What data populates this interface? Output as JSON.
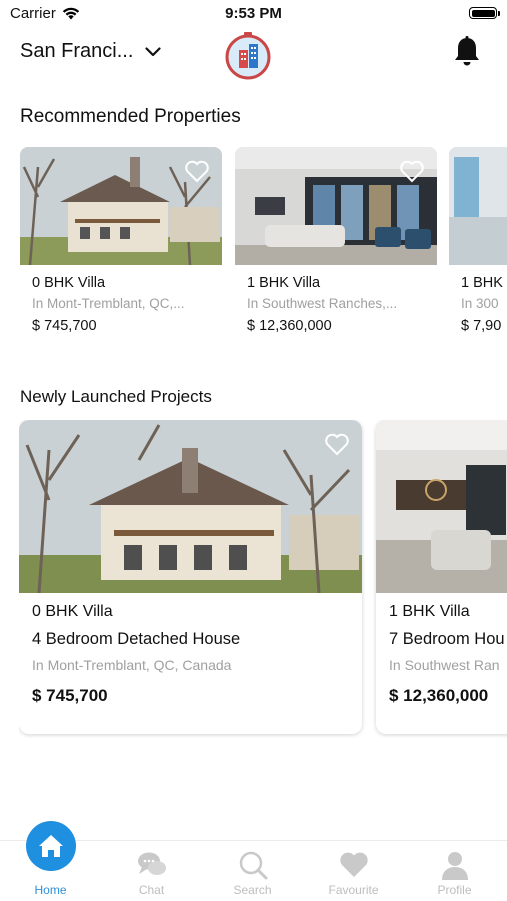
{
  "status": {
    "carrier": "Carrier",
    "time": "9:53 PM"
  },
  "header": {
    "city": "San Franci...",
    "icons": [
      "chevron-down-icon",
      "app-logo",
      "bell-icon"
    ]
  },
  "recommended": {
    "title": "Recommended Properties",
    "cards": [
      {
        "type": "0 BHK Villa",
        "location": "In Mont-Tremblant, QC,...",
        "price": "$ 745,700"
      },
      {
        "type": "1 BHK Villa",
        "location": "In Southwest Ranches,...",
        "price": "$ 12,360,000"
      },
      {
        "type": "1 BHK",
        "location": "In 300",
        "price": "$ 7,90"
      }
    ]
  },
  "new_projects": {
    "title": "Newly Launched Projects",
    "cards": [
      {
        "type": "0 BHK Villa",
        "name": "4 Bedroom Detached House",
        "location": "In Mont-Tremblant, QC, Canada",
        "price": "$ 745,700"
      },
      {
        "type": "1 BHK Villa",
        "name": "7 Bedroom Hou",
        "location": "In Southwest Ran",
        "price": "$ 12,360,000"
      }
    ]
  },
  "tabs": [
    {
      "label": "Home",
      "icon": "home-icon",
      "active": true
    },
    {
      "label": "Chat",
      "icon": "chat-icon"
    },
    {
      "label": "Search",
      "icon": "search-icon"
    },
    {
      "label": "Favourite",
      "icon": "heart-icon"
    },
    {
      "label": "Profile",
      "icon": "profile-icon"
    }
  ],
  "colors": {
    "accent": "#1f8fe0",
    "tab_inactive": "#bdbdbd",
    "muted_text": "#a0a0a0"
  }
}
